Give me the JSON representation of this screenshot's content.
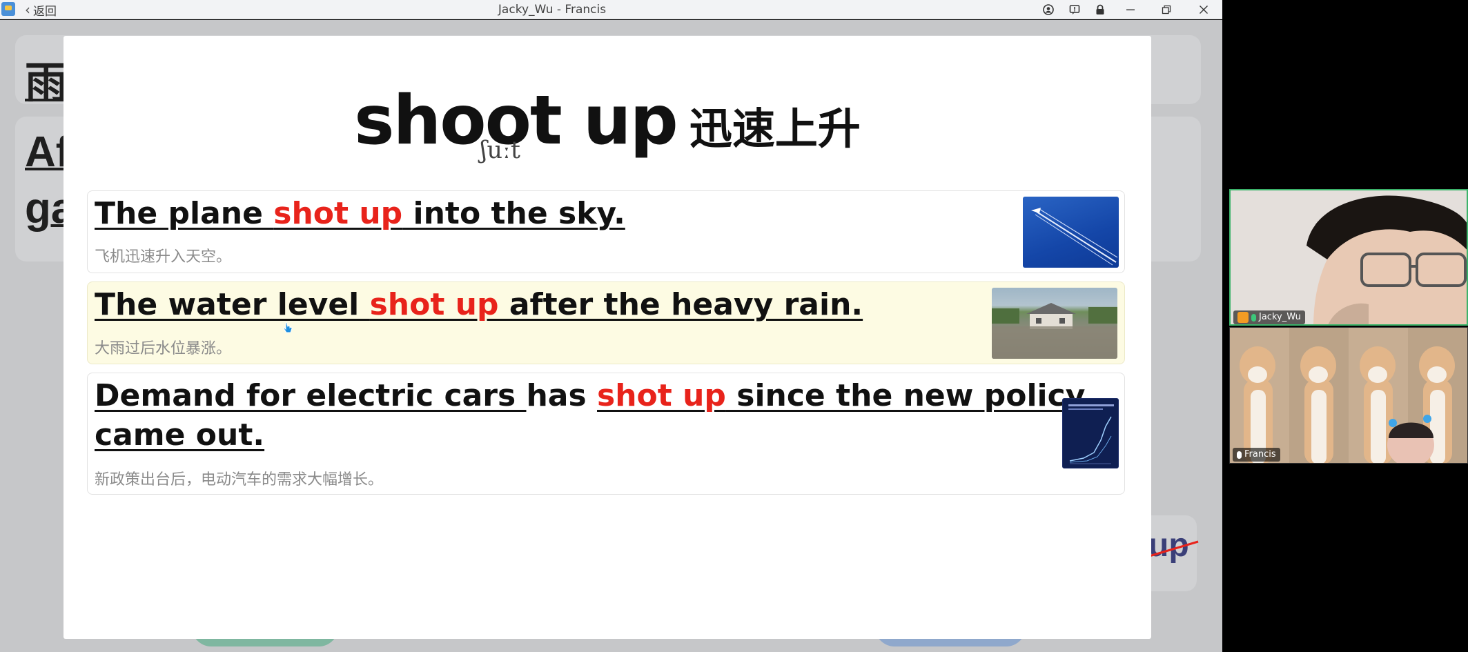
{
  "window": {
    "title": "Jacky_Wu - Francis",
    "back_label": "返回"
  },
  "background": {
    "word1": "雨",
    "word2a": "Af",
    "word2b": "ga",
    "word3": "up"
  },
  "slide": {
    "headline_en": "shoot up",
    "headline_cn": "迅速上升",
    "phonetic": "ʃuːt",
    "rows": [
      {
        "before": "The plane ",
        "highlight": "shot up",
        "after": " into the sky.",
        "after2": "",
        "translation": "飞机迅速升入天空。"
      },
      {
        "before": "The water level ",
        "highlight": "shot up",
        "after": " after the heavy rain.",
        "after2": "",
        "translation": "大雨过后水位暴涨。"
      },
      {
        "before": "Demand for electric cars ",
        "before2": "has ",
        "highlight": "shot up",
        "after": " since the new policy",
        "after2": "came out.",
        "translation": "新政策出台后，电动汽车的需求大幅增长。"
      }
    ]
  },
  "participants": [
    {
      "name": "Jacky_Wu"
    },
    {
      "name": "Francis"
    }
  ],
  "colors": {
    "highlight_red": "#e8231b",
    "active_speaker_border": "#3bb36a",
    "row_highlight": "#fdfbe3"
  }
}
